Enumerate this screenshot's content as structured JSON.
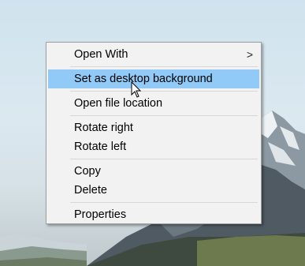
{
  "context_menu": {
    "items": [
      {
        "label": "Open With",
        "has_submenu": true,
        "highlighted": false
      },
      {
        "label": "Set as desktop background",
        "has_submenu": false,
        "highlighted": true
      },
      {
        "label": "Open file location",
        "has_submenu": false,
        "highlighted": false
      },
      {
        "label": "Rotate right",
        "has_submenu": false,
        "highlighted": false
      },
      {
        "label": "Rotate left",
        "has_submenu": false,
        "highlighted": false
      },
      {
        "label": "Copy",
        "has_submenu": false,
        "highlighted": false
      },
      {
        "label": "Delete",
        "has_submenu": false,
        "highlighted": false
      },
      {
        "label": "Properties",
        "has_submenu": false,
        "highlighted": false
      }
    ],
    "submenu_glyph": ">"
  },
  "colors": {
    "menu_background": "#f2f2f2",
    "highlight": "#91c9f7",
    "separator": "#d7d7d7"
  }
}
